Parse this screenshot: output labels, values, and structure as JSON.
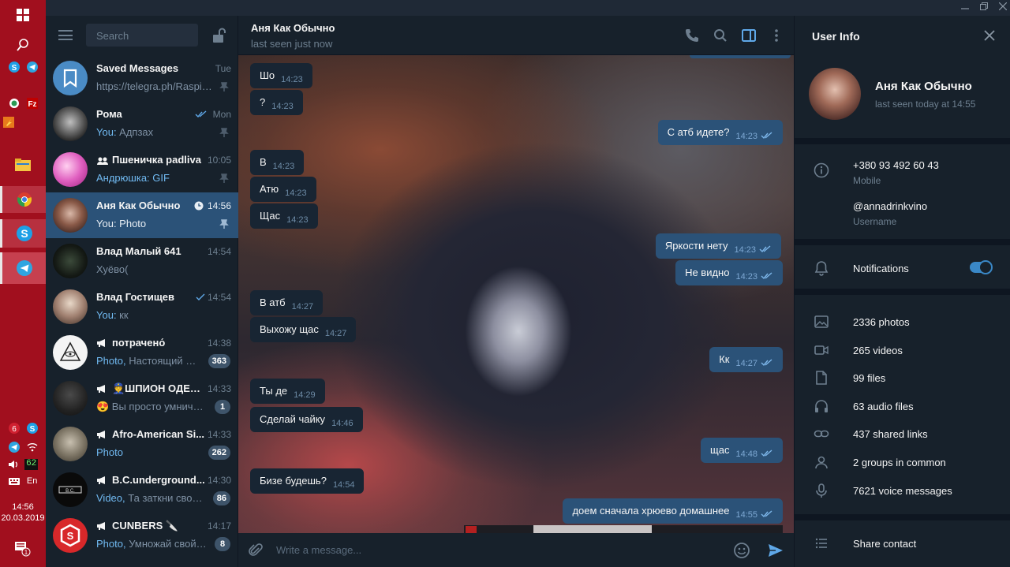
{
  "taskbar": {
    "lang": "En",
    "battery": "62",
    "clock_time": "14:56",
    "clock_date": "20.03.2019",
    "notification_count": "1"
  },
  "sidebar": {
    "search_placeholder": "Search",
    "chats": [
      {
        "name": "Saved Messages",
        "time": "Tue",
        "who": "",
        "preview": "https://telegra.ph/Raspis...",
        "badge": "",
        "pinned": true,
        "read": false,
        "type": "saved"
      },
      {
        "name": "Рома",
        "time": "Mon",
        "who": "You:",
        "preview": " Адпзах",
        "badge": "",
        "pinned": true,
        "read": true,
        "type": "user"
      },
      {
        "name": "Пшеничка padliva",
        "time": "10:05",
        "who": "Андрюшка:",
        "preview": " GIF",
        "badge": "",
        "pinned": true,
        "read": false,
        "type": "group"
      },
      {
        "name": "Аня Как Обычно",
        "time": "14:56",
        "who": "You:",
        "preview": " Photo",
        "badge": "",
        "pinned": true,
        "read": false,
        "type": "user",
        "active": true,
        "sending": true
      },
      {
        "name": "Влад Малый 641",
        "time": "14:54",
        "who": "",
        "preview": "Хуёво(",
        "badge": "",
        "pinned": false,
        "read": false,
        "type": "user"
      },
      {
        "name": "Влад Гостищев",
        "time": "14:54",
        "who": "You:",
        "preview": " кк",
        "badge": "",
        "pinned": false,
        "read": true,
        "single": true,
        "type": "user"
      },
      {
        "name": "потрачено́",
        "time": "14:38",
        "who": "Photo,",
        "preview": " Настоящий му...",
        "badge": "363",
        "pinned": false,
        "read": false,
        "type": "channel"
      },
      {
        "name": "👮ШПИОН ОДЕС...",
        "time": "14:33",
        "who": "",
        "preview": "😍 Вы просто умнички...",
        "badge": "1",
        "pinned": false,
        "read": false,
        "type": "channel"
      },
      {
        "name": "Afro-American Si...",
        "time": "14:33",
        "who": "Photo",
        "preview": "",
        "badge": "262",
        "pinned": false,
        "read": false,
        "type": "channel"
      },
      {
        "name": "B.C.underground...",
        "time": "14:30",
        "who": "Video,",
        "preview": " Та заткни свою е...",
        "badge": "86",
        "pinned": false,
        "read": false,
        "type": "channel"
      },
      {
        "name": "CUNBERS 🔪",
        "time": "14:17",
        "who": "Photo,",
        "preview": " Умножай свой в...",
        "badge": "8",
        "pinned": false,
        "read": false,
        "type": "channel"
      }
    ]
  },
  "chat": {
    "title": "Аня Как Обычно",
    "status": "last seen just now",
    "composer_placeholder": "Write a message...",
    "messages": [
      {
        "dir": "in",
        "text": "Шо",
        "time": "14:23"
      },
      {
        "dir": "in",
        "text": "?",
        "time": "14:23"
      },
      {
        "dir": "out",
        "text": "С атб идете?",
        "time": "14:23"
      },
      {
        "dir": "in",
        "text": "В",
        "time": "14:23"
      },
      {
        "dir": "in",
        "text": "Атю",
        "time": "14:23"
      },
      {
        "dir": "in",
        "text": "Щас",
        "time": "14:23"
      },
      {
        "dir": "out",
        "text": "Яркости нету",
        "time": "14:23"
      },
      {
        "dir": "out",
        "text": "Не видно",
        "time": "14:23"
      },
      {
        "dir": "in",
        "text": "В атб",
        "time": "14:27"
      },
      {
        "dir": "in",
        "text": "Выхожу щас",
        "time": "14:27"
      },
      {
        "dir": "out",
        "text": "Кк",
        "time": "14:27"
      },
      {
        "dir": "in",
        "text": "Ты де",
        "time": "14:29"
      },
      {
        "dir": "in",
        "text": "Сделай чайку",
        "time": "14:46"
      },
      {
        "dir": "out",
        "text": "щас",
        "time": "14:48"
      },
      {
        "dir": "in",
        "text": "Бизе будешь?",
        "time": "14:54"
      },
      {
        "dir": "out",
        "text": "доем сначала хрюево домашнее",
        "time": "14:55"
      }
    ]
  },
  "info": {
    "title": "User Info",
    "name": "Аня Как Обычно",
    "seen": "last seen today at 14:55",
    "phone": "+380 93 492 60 43",
    "phone_label": "Mobile",
    "username": "@annadrinkvino",
    "username_label": "Username",
    "notifications": "Notifications",
    "notifications_on": true,
    "media": [
      {
        "icon": "photo-icon",
        "label": "2336 photos"
      },
      {
        "icon": "video-icon",
        "label": "265 videos"
      },
      {
        "icon": "file-icon",
        "label": "99 files"
      },
      {
        "icon": "headphones-icon",
        "label": "63 audio files"
      },
      {
        "icon": "link-icon",
        "label": "437 shared links"
      },
      {
        "icon": "person-icon",
        "label": "2 groups in common"
      },
      {
        "icon": "mic-icon",
        "label": "7621 voice messages"
      }
    ],
    "share_contact": "Share contact"
  },
  "colors": {
    "taskbar": "#a10f1e",
    "bg": "#17212b",
    "active": "#2b5278",
    "bubble_in": "#182533",
    "accent": "#3a88c7"
  }
}
